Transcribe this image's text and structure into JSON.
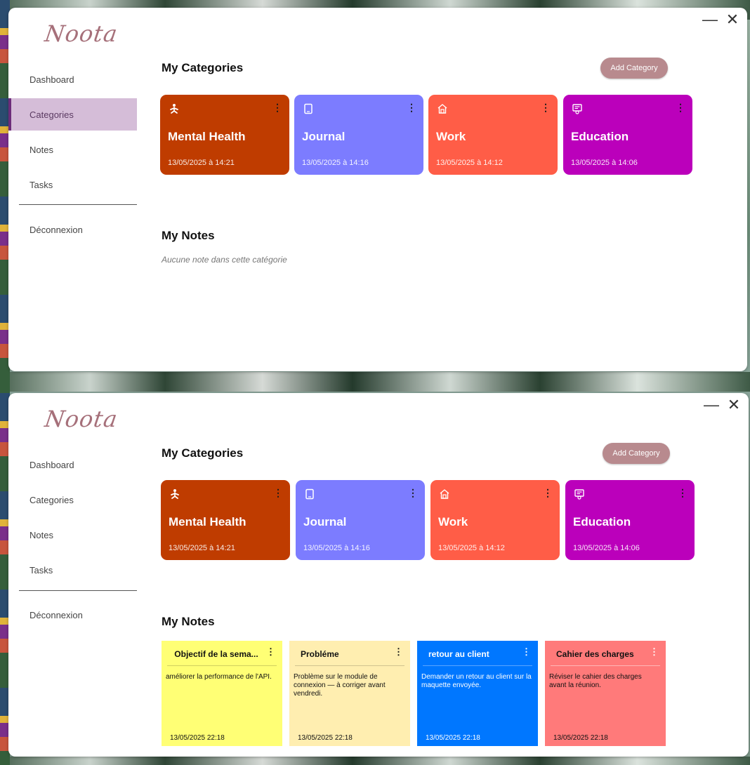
{
  "app": {
    "logo": "Noota",
    "minimize_glyph": "—",
    "close_glyph": "✕"
  },
  "nav": [
    "Dashboard",
    "Categories",
    "Notes",
    "Tasks",
    "Déconnexion"
  ],
  "categories_title": "My Categories",
  "add_category_label": "Add Category",
  "notes_title": "My Notes",
  "categories": [
    {
      "name": "Mental Health",
      "date": "13/05/2025 à 14:21",
      "color": "#bf3c00",
      "icon": "meditation-icon",
      "menu": "⋮"
    },
    {
      "name": "Journal",
      "date": "13/05/2025 à 14:16",
      "color": "#7c7cff",
      "icon": "tablet-icon",
      "menu": "⋮"
    },
    {
      "name": "Work",
      "date": "13/05/2025 à 14:12",
      "color": "#ff5d47",
      "icon": "office-icon",
      "menu": "⋮"
    },
    {
      "name": "Education",
      "date": "13/05/2025 à 14:06",
      "color": "#bb00bb",
      "icon": "certificate-icon",
      "menu": "⋮"
    }
  ],
  "screens": [
    {
      "active_nav": "Categories",
      "empty_notes_message": "Aucune note dans cette catégorie"
    },
    {
      "active_nav": "",
      "notes": [
        {
          "title": "Objectif de la sema...",
          "body": "améliorer la performance de l'API.",
          "date": "13/05/2025 22:18",
          "color": "#ffff75",
          "menu": "⋮"
        },
        {
          "title": "Probléme",
          "body": "Problème sur le module de connexion — à corriger avant vendredi.",
          "date": "13/05/2025 22:18",
          "color": "#ffeeb0",
          "menu": "⋮"
        },
        {
          "title": "retour au client",
          "body": "Demander un retour au client sur la maquette envoyée.",
          "date": "13/05/2025 22:18",
          "color": "#0077ff",
          "menu": "⋮"
        },
        {
          "title": "Cahier des charges",
          "body": "Réviser le cahier des charges avant la réunion.",
          "date": "13/05/2025 22:18",
          "color": "#ff7a7a",
          "menu": "⋮"
        }
      ]
    }
  ]
}
